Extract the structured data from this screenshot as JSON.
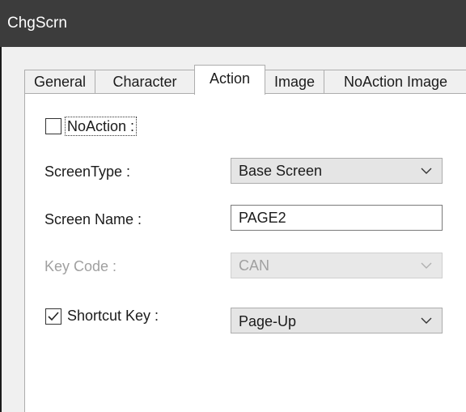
{
  "window": {
    "title": "ChgScrn"
  },
  "tabs": [
    {
      "label": "General",
      "active": false
    },
    {
      "label": "Character",
      "active": false
    },
    {
      "label": "Action",
      "active": true
    },
    {
      "label": "Image",
      "active": false
    },
    {
      "label": "NoAction Image",
      "active": false
    }
  ],
  "form": {
    "no_action": {
      "label": "NoAction :",
      "checked": false
    },
    "screen_type": {
      "label": "ScreenType :",
      "value": "Base Screen"
    },
    "screen_name": {
      "label": "Screen Name :",
      "value": "PAGE2"
    },
    "key_code": {
      "label": "Key Code :",
      "value": "CAN",
      "enabled": false
    },
    "shortcut_key": {
      "label": "Shortcut Key :",
      "checked": true,
      "value": "Page-Up"
    }
  },
  "icons": {
    "dropdown": "chevron-down-icon",
    "check": "checkmark-icon"
  }
}
